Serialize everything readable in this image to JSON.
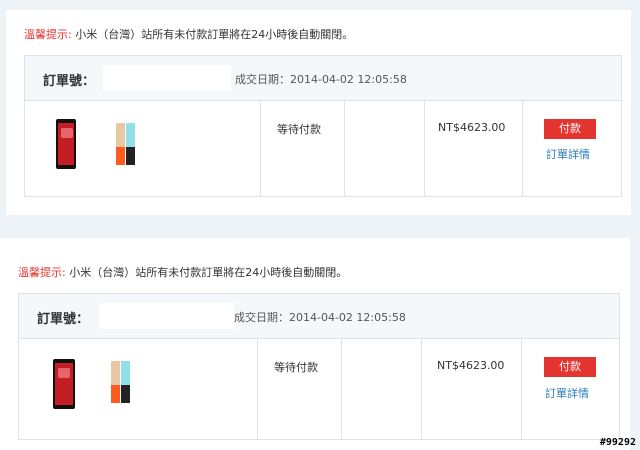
{
  "notice": {
    "warning": "溫馨提示:",
    "message": " 小米（台灣）站所有未付款訂單將在24小時後自動關閉。"
  },
  "orders": [
    {
      "order_label": "訂單號：",
      "date": "成交日期：2014-04-02 12:05:58",
      "status": "等待付款",
      "price": "NT$4623.00",
      "pay_label": "付款",
      "detail_label": "訂單詳情"
    },
    {
      "order_label": "訂單號：",
      "date": "成交日期：2014-04-02 12:05:58",
      "status": "等待付款",
      "price": "NT$4623.00",
      "pay_label": "付款",
      "detail_label": "訂單詳情"
    }
  ],
  "icons": {
    "product_phone": "phone-icon",
    "product_powerbank": "powerbank-icon"
  },
  "colors": {
    "warning": "#e3342f",
    "pay_button": "#e3342f",
    "link": "#2a7bb8"
  },
  "watermark": "#99292"
}
